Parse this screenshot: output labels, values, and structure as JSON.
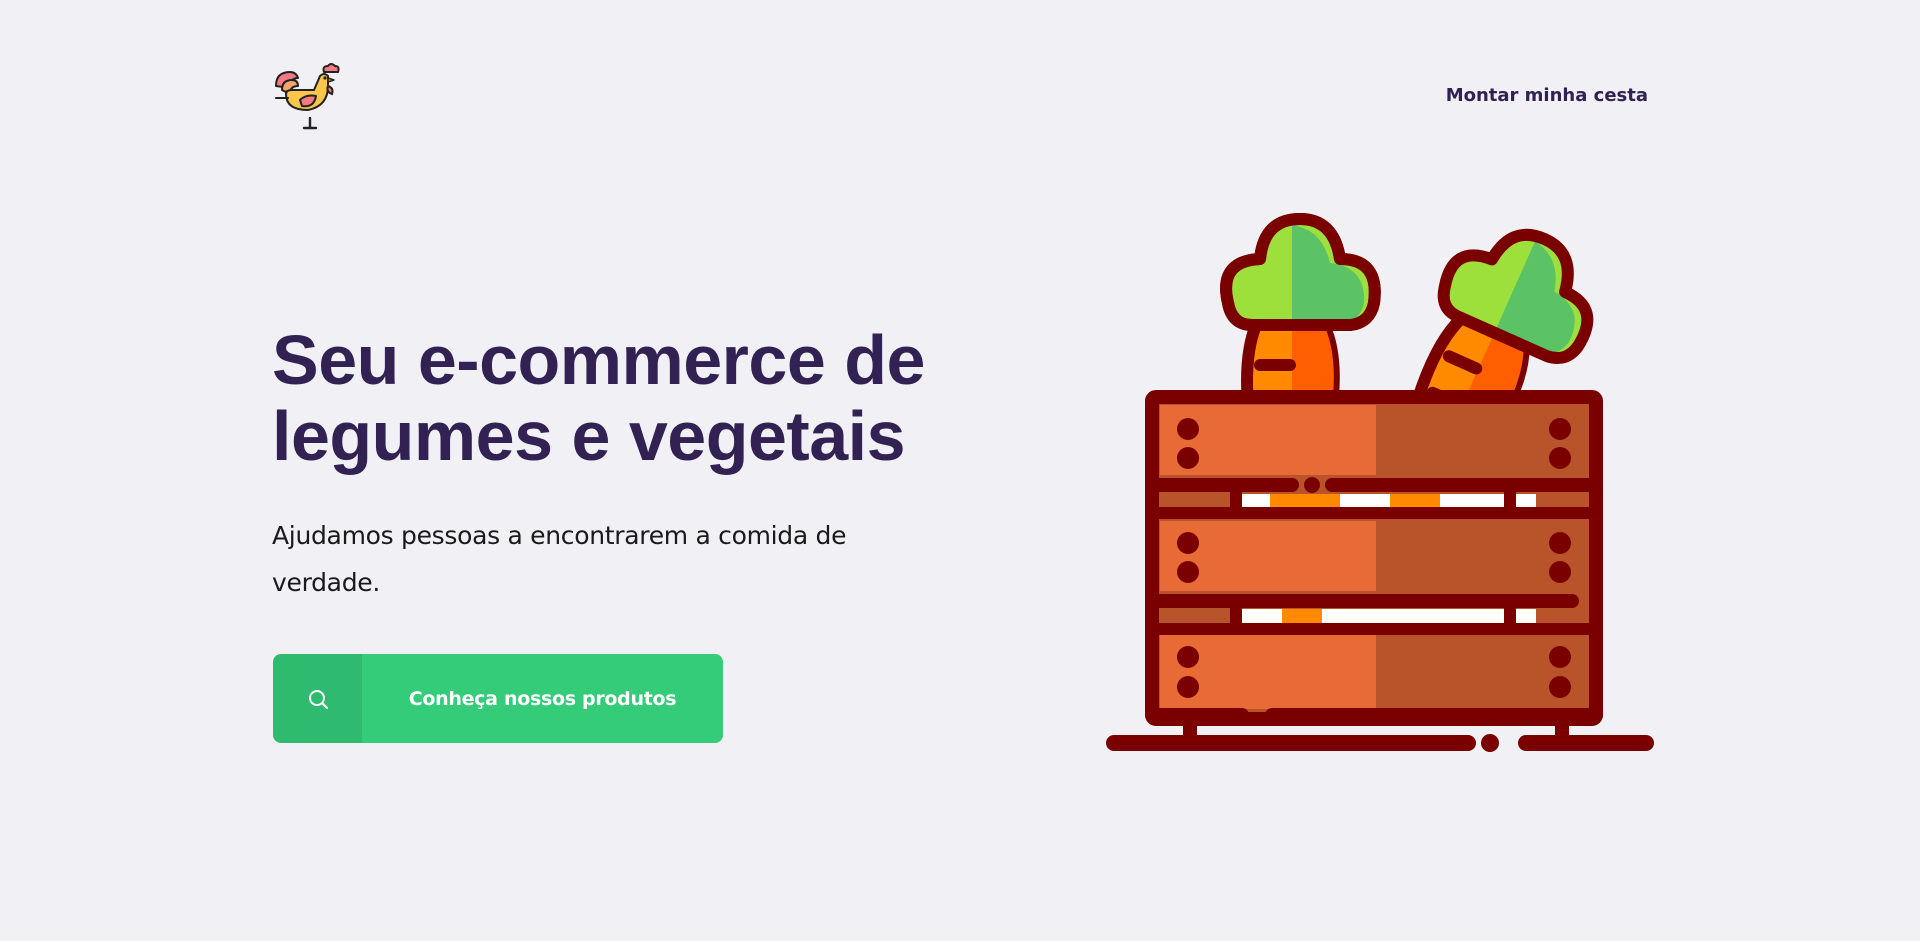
{
  "header": {
    "logo_icon": "rooster-icon",
    "nav_link": "Montar minha cesta"
  },
  "hero": {
    "title_line1": "Seu e-commerce de",
    "title_line2": "legumes e vegetais",
    "subtitle": "Ajudamos pessoas a encontrarem a comida de verdade.",
    "cta_label": "Conheça nossos produtos",
    "cta_icon": "search-icon"
  },
  "illustration": {
    "icon": "carrot-crate-icon"
  },
  "colors": {
    "background": "#f0f0f5",
    "title": "#322153",
    "primary": "#34cb79",
    "crate_dark": "#7a0000",
    "crate_light": "#e86a36",
    "crate_shade": "#b9532a",
    "carrot": "#ff8a00",
    "carrot_dark": "#ff5f00",
    "leaf": "#9de03c",
    "leaf_dark": "#5bc266"
  }
}
